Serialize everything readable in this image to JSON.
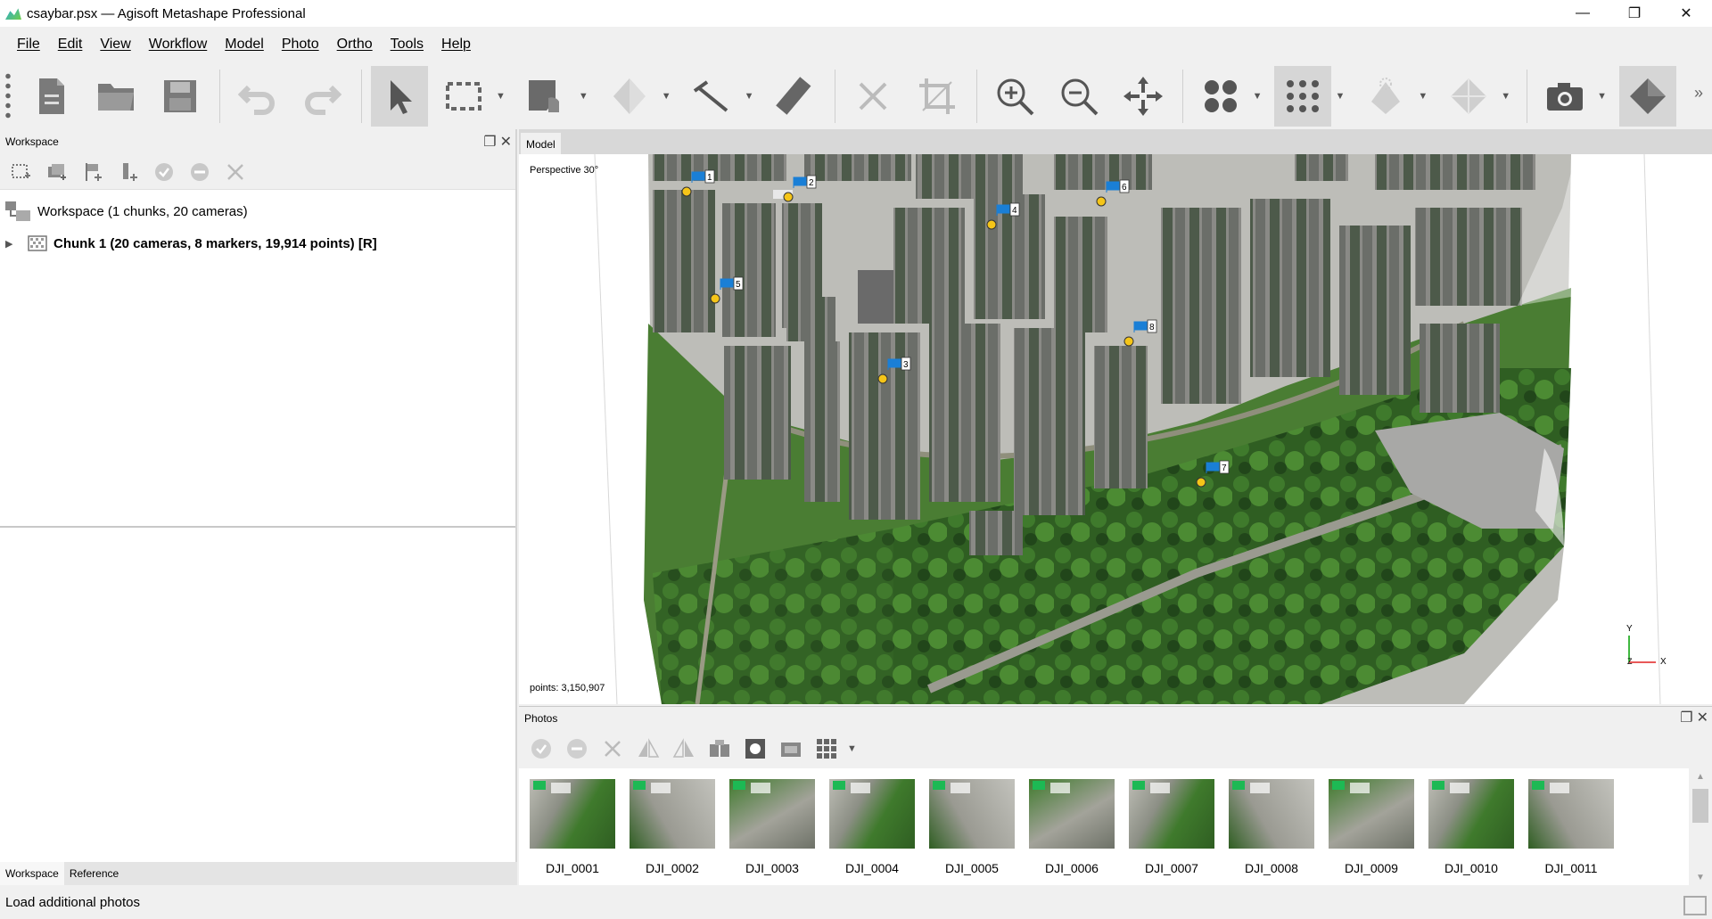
{
  "window": {
    "title": "csaybar.psx — Agisoft Metashape Professional",
    "minimize": "—",
    "restore": "❐",
    "close": "✕"
  },
  "menu": [
    "File",
    "Edit",
    "View",
    "Workflow",
    "Model",
    "Photo",
    "Ortho",
    "Tools",
    "Help"
  ],
  "toolbar": {
    "icons": [
      "new-document-icon",
      "open-folder-icon",
      "save-icon",
      "undo-icon",
      "redo-icon",
      "navigation-arrow-icon",
      "rectangle-selection-icon",
      "move-object-icon",
      "rotate-object-icon",
      "ruler-line-icon",
      "ruler-icon",
      "delete-icon",
      "crop-icon",
      "zoom-in-icon",
      "zoom-out-icon",
      "reset-view-icon",
      "points-view-icon",
      "dense-points-view-icon",
      "shading-icon",
      "model-view-icon",
      "camera-icon",
      "show-markers-icon"
    ]
  },
  "workspace": {
    "panel_title": "Workspace",
    "root_label": "Workspace (1 chunks, 20 cameras)",
    "chunk_label": "Chunk 1 (20 cameras, 8 markers, 19,914 points) [R]",
    "tabs": [
      "Workspace",
      "Reference"
    ]
  },
  "model": {
    "tab_label": "Model",
    "perspective": "Perspective 30°",
    "points": "points: 3,150,907",
    "axis_y": "Y",
    "axis_x": "X",
    "axis_z": "Z",
    "markers": [
      "1",
      "2",
      "3",
      "4",
      "5",
      "6",
      "7",
      "8"
    ]
  },
  "photos": {
    "panel_title": "Photos",
    "items": [
      "DJI_0001",
      "DJI_0002",
      "DJI_0003",
      "DJI_0004",
      "DJI_0005",
      "DJI_0006",
      "DJI_0007",
      "DJI_0008",
      "DJI_0009",
      "DJI_0010",
      "DJI_0011"
    ]
  },
  "status": {
    "text": "Load additional photos"
  },
  "colors": {
    "marker_flag": "#1a7fd6",
    "marker_dot": "#f5c518",
    "vegetation": "#3f7a2c",
    "pavement": "#a9a9a9"
  }
}
